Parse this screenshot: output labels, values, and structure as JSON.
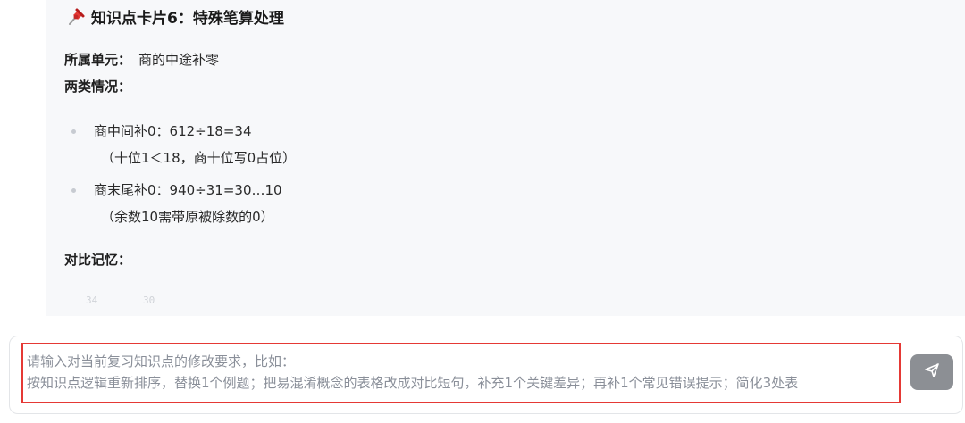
{
  "card": {
    "title": "知识点卡片6：特殊笔算处理",
    "unit_label": "所属单元：",
    "unit_value": "商的中途补零",
    "cases_heading": "两类情况：",
    "cases": [
      {
        "line1": "商中间补0：612÷18=34",
        "line2": "（十位1＜18，商十位写0占位）"
      },
      {
        "line1": "商末尾补0：940÷31=30…10",
        "line2": "（余数10需带原被除数的0）"
      }
    ],
    "compare_heading": "对比记忆：",
    "faint_values": [
      "34",
      "30"
    ]
  },
  "input": {
    "placeholder": "请输入对当前复习知识点的修改要求，比如：\n按知识点逻辑重新排序，替换1个例题；把易混淆概念的表格改成对比短句，补充1个关键差异；再补1个常见错误提示；简化3处表"
  },
  "icons": {
    "pin": "pushpin-icon",
    "send": "send-icon"
  },
  "colors": {
    "highlight_border": "#e53935",
    "send_button": "#8c8f94",
    "card_background": "#f7f8fa"
  }
}
